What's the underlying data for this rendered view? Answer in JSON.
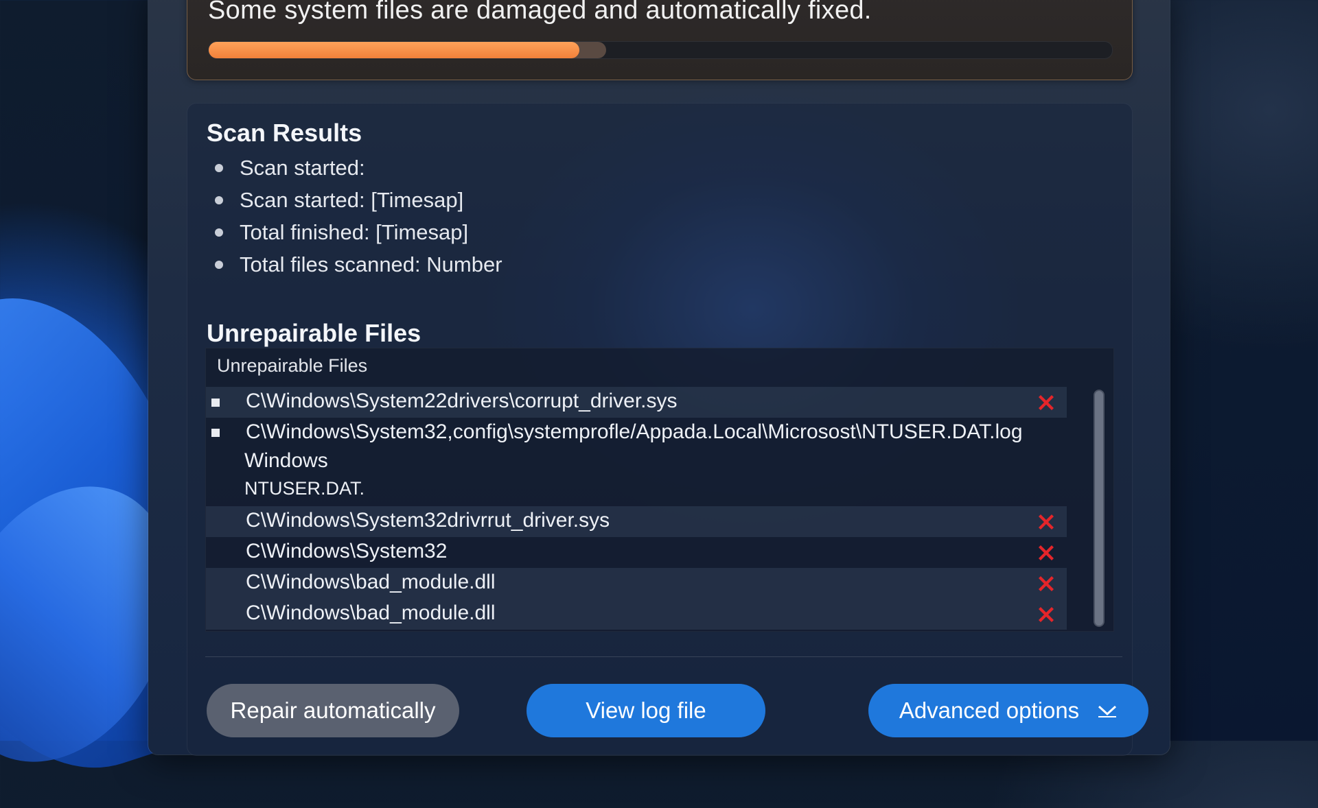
{
  "status": {
    "message": "Some system files are damaged and automatically fixed.",
    "progress_percent": 41,
    "buffer_percent": 44
  },
  "scan_results": {
    "title": "Scan Results",
    "items": [
      "Scan started:",
      "Scan started: [Timesap]",
      "Total finished: [Timesap]",
      "Total files scanned: Number"
    ]
  },
  "unrepairable": {
    "title": "Unrepairable Files",
    "list_header": "Unrepairable Files",
    "rows": [
      {
        "path": "C\\Windows\\System22drivers\\corrupt_driver.sys"
      },
      {
        "path": "C\\Windows\\System32,config\\systemprofle/Appada.Local\\Microsost\\NTUSER.DAT.log",
        "line2": "Windows",
        "line3": "NTUSER.DAT."
      },
      {
        "path": "C\\Windows\\System32drivrrut_driver.sys"
      },
      {
        "path": "C\\Windows\\System32"
      },
      {
        "path": "C\\Windows\\bad_module.dll"
      },
      {
        "path": "C\\Windows\\bad_module.dll"
      }
    ]
  },
  "buttons": {
    "repair": "Repair automatically",
    "view_log": "View log file",
    "advanced": "Advanced options"
  },
  "colors": {
    "progress": "#f2813a",
    "accent": "#1f78dc",
    "error": "#e5252a"
  },
  "icons": {
    "remove": "close-x-icon",
    "dropdown": "chevron-down-icon"
  }
}
